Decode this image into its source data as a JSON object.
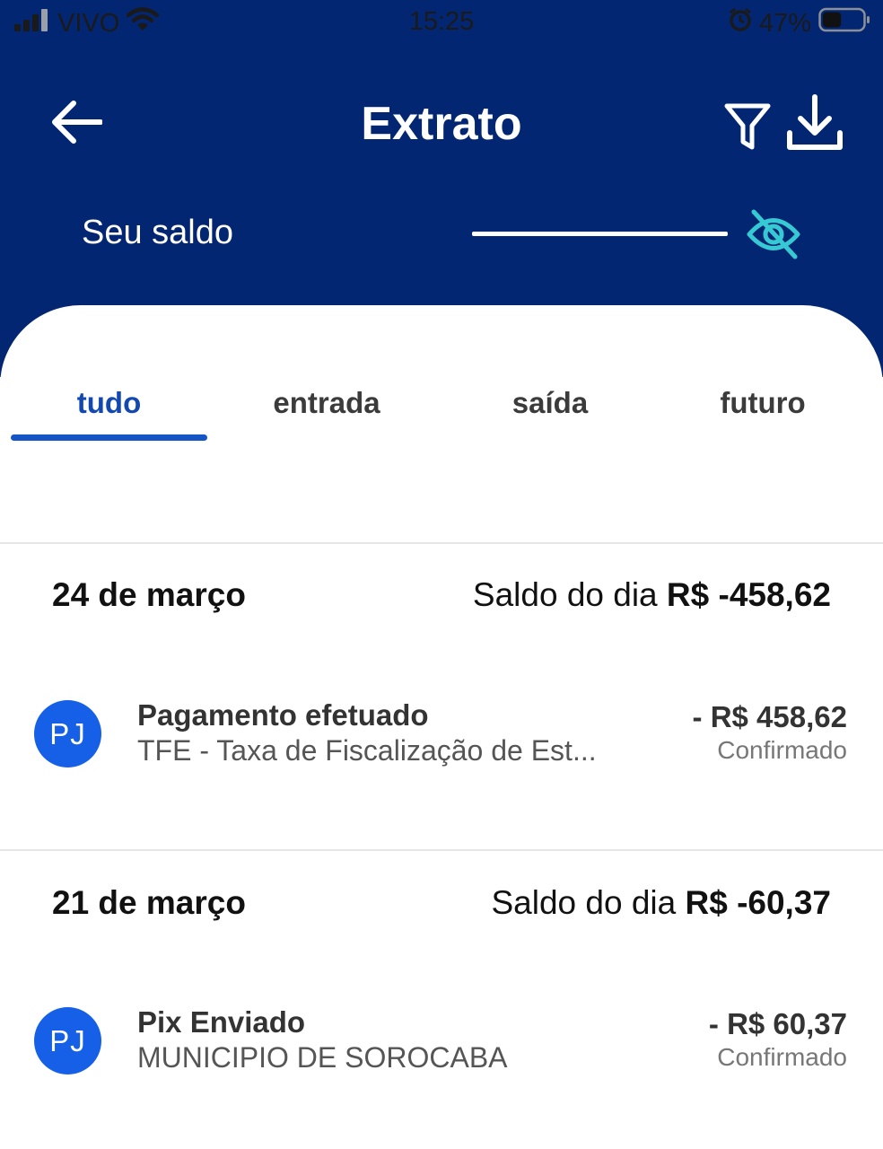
{
  "status_bar": {
    "carrier": "VIVO",
    "time": "15:25",
    "battery": "47%",
    "battery_level": 0.47
  },
  "header": {
    "title": "Extrato",
    "balance_label": "Seu saldo",
    "icons": {
      "back": "arrow-left-icon",
      "filter": "filter-icon",
      "download": "download-icon",
      "visibility": "eye-off-icon"
    }
  },
  "tabs": [
    {
      "label": "tudo",
      "active": true
    },
    {
      "label": "entrada",
      "active": false
    },
    {
      "label": "saída",
      "active": false
    },
    {
      "label": "futuro",
      "active": false
    }
  ],
  "days": [
    {
      "date": "24 de março",
      "balance_label": "Saldo do dia",
      "balance": "R$ -458,62",
      "transactions": [
        {
          "avatar": "PJ",
          "title": "Pagamento efetuado",
          "description": "TFE - Taxa de Fiscalização de Est...",
          "amount": "- R$ 458,62",
          "status": "Confirmado"
        }
      ]
    },
    {
      "date": "21 de março",
      "balance_label": "Saldo do dia",
      "balance": "R$ -60,37",
      "transactions": [
        {
          "avatar": "PJ",
          "title": "Pix Enviado",
          "description": "MUNICIPIO DE SOROCABA",
          "amount": "- R$ 60,37",
          "status": "Confirmado"
        }
      ]
    }
  ],
  "colors": {
    "header_bg": "#032672",
    "accent_blue": "#1555c6",
    "avatar_bg": "#1560e6",
    "eye_icon": "#36c9d4"
  }
}
